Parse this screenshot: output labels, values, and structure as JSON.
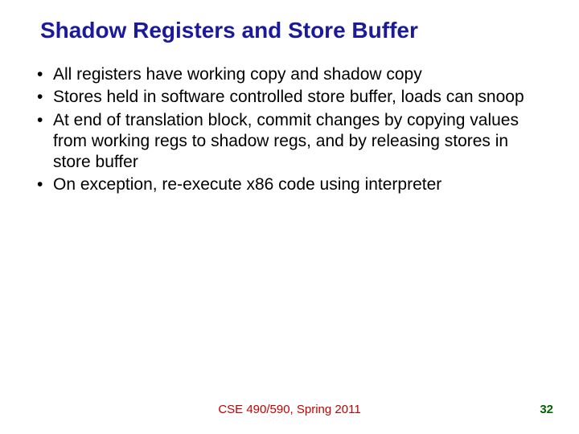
{
  "title": "Shadow Registers and Store Buffer",
  "bullets": [
    "All registers have working copy and shadow copy",
    "Stores held in software controlled store buffer, loads can snoop",
    "At end of translation block, commit changes by copying values from working regs to shadow regs, and by releasing stores in store buffer",
    "On exception, re-execute x86 code using interpreter"
  ],
  "footer": {
    "center": "CSE 490/590, Spring 2011",
    "page": "32"
  }
}
